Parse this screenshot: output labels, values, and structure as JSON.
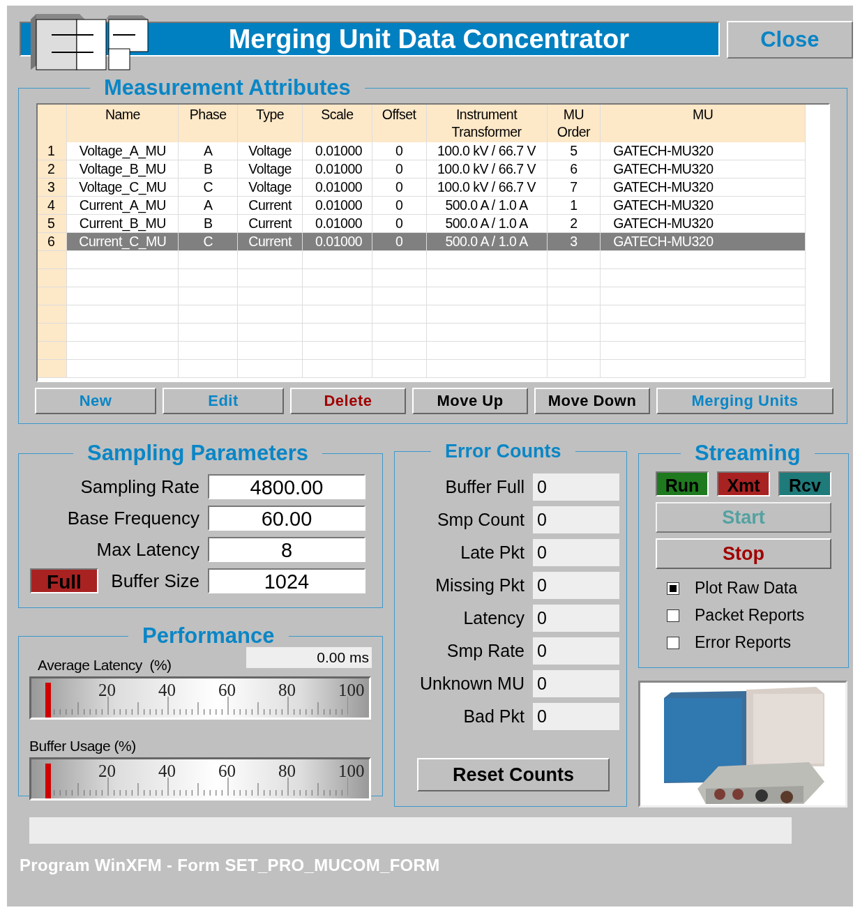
{
  "window": {
    "title": "Merging Unit Data Concentrator",
    "close": "Close"
  },
  "measurement": {
    "title": "Measurement Attributes",
    "columns": [
      "Name",
      "Phase",
      "Type",
      "Scale",
      "Offset",
      "Instrument Transformer",
      "MU Order",
      "MU"
    ],
    "rows": [
      {
        "num": "1",
        "cells": [
          "Voltage_A_MU",
          "A",
          "Voltage",
          "0.01000",
          "0",
          "100.0 kV / 66.7 V",
          "5",
          "GATECH-MU320"
        ],
        "selected": false
      },
      {
        "num": "2",
        "cells": [
          "Voltage_B_MU",
          "B",
          "Voltage",
          "0.01000",
          "0",
          "100.0 kV / 66.7 V",
          "6",
          "GATECH-MU320"
        ],
        "selected": false
      },
      {
        "num": "3",
        "cells": [
          "Voltage_C_MU",
          "C",
          "Voltage",
          "0.01000",
          "0",
          "100.0 kV / 66.7 V",
          "7",
          "GATECH-MU320"
        ],
        "selected": false
      },
      {
        "num": "4",
        "cells": [
          "Current_A_MU",
          "A",
          "Current",
          "0.01000",
          "0",
          "500.0 A / 1.0 A",
          "1",
          "GATECH-MU320"
        ],
        "selected": false
      },
      {
        "num": "5",
        "cells": [
          "Current_B_MU",
          "B",
          "Current",
          "0.01000",
          "0",
          "500.0 A / 1.0 A",
          "2",
          "GATECH-MU320"
        ],
        "selected": false
      },
      {
        "num": "6",
        "cells": [
          "Current_C_MU",
          "C",
          "Current",
          "0.01000",
          "0",
          "500.0 A / 1.0 A",
          "3",
          "GATECH-MU320"
        ],
        "selected": true
      }
    ],
    "buttons": [
      {
        "label": "New",
        "kind": "link"
      },
      {
        "label": "Edit",
        "kind": "link"
      },
      {
        "label": "Delete",
        "kind": "danger"
      },
      {
        "label": "Move Up",
        "kind": "plain"
      },
      {
        "label": "Move Down",
        "kind": "plain"
      },
      {
        "label": "Merging Units",
        "kind": "link"
      }
    ]
  },
  "sampling": {
    "title": "Sampling Parameters",
    "fields": [
      {
        "label": "Sampling Rate",
        "value": "4800.00"
      },
      {
        "label": "Base Frequency",
        "value": "60.00"
      },
      {
        "label": "Max Latency",
        "value": "8"
      },
      {
        "label": "Buffer Size",
        "value": "1024",
        "indicator": {
          "label": "Full",
          "on": false
        }
      }
    ]
  },
  "performance": {
    "title": "Performance",
    "latency_reading": "0.00 ms",
    "gauges": [
      {
        "label": "Average Latency  (%)",
        "level": 0,
        "scale": [
          "20",
          "40",
          "60",
          "80",
          "100"
        ]
      },
      {
        "label": "Buffer Usage (%)",
        "level": 0,
        "scale": [
          "20",
          "40",
          "60",
          "80",
          "100"
        ]
      }
    ]
  },
  "errors": {
    "title": "Error Counts",
    "counts": [
      {
        "label": "Buffer Full",
        "value": "0"
      },
      {
        "label": "Smp Count",
        "value": "0"
      },
      {
        "label": "Late Pkt",
        "value": "0"
      },
      {
        "label": "Missing Pkt",
        "value": "0"
      },
      {
        "label": "Latency",
        "value": "0"
      },
      {
        "label": "Smp Rate",
        "value": "0"
      },
      {
        "label": "Unknown MU",
        "value": "0"
      },
      {
        "label": "Bad Pkt",
        "value": "0"
      }
    ],
    "reset": "Reset Counts"
  },
  "streaming": {
    "title": "Streaming",
    "indicators": [
      {
        "label": "Run",
        "kind": "run",
        "on": false
      },
      {
        "label": "Xmt",
        "kind": "xmt",
        "on": false
      },
      {
        "label": "Rcv",
        "kind": "rcv",
        "on": false
      }
    ],
    "start": {
      "label": "Start",
      "disabled": true
    },
    "stop": {
      "label": "Stop",
      "disabled": false
    },
    "options": [
      {
        "label": "Plot Raw Data",
        "checked": true
      },
      {
        "label": "Packet Reports",
        "checked": false
      },
      {
        "label": "Error Reports",
        "checked": false
      }
    ]
  },
  "footer": "Program WinXFM - Form SET_PRO_MUCOM_FORM"
}
